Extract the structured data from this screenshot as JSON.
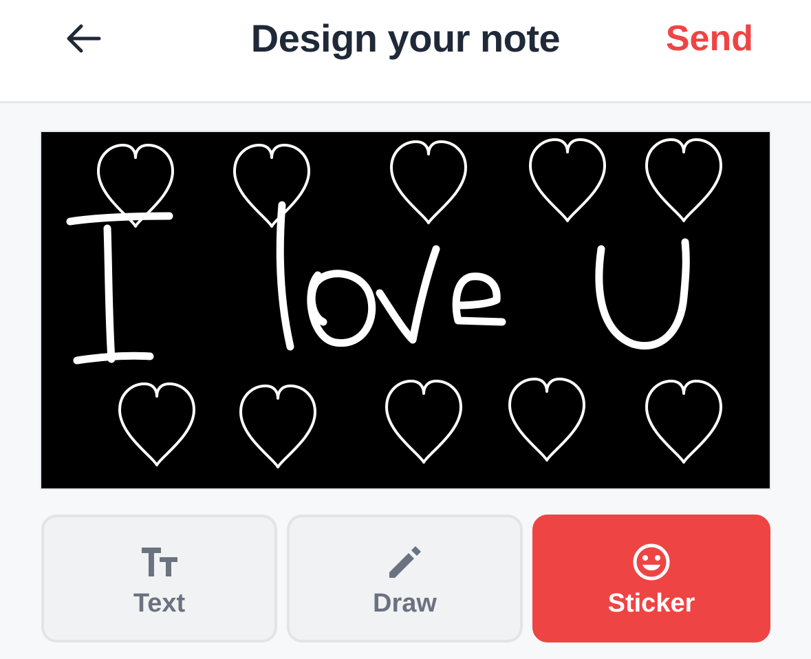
{
  "header": {
    "back_icon": "arrow-left-icon",
    "title": "Design your note",
    "send_label": "Send"
  },
  "canvas": {
    "background": "#000000",
    "ink_color": "#ffffff",
    "handwriting": "I love U",
    "sticker_icon": "heart-outline-icon",
    "sticker_count": 10
  },
  "tools": {
    "text": {
      "label": "Text",
      "icon": "text-size-icon"
    },
    "draw": {
      "label": "Draw",
      "icon": "pencil-icon"
    },
    "sticker": {
      "label": "Sticker",
      "icon": "smiley-face-icon",
      "selected": true
    }
  },
  "colors": {
    "accent": "#ef4444",
    "title": "#1f2937",
    "muted": "#6b7280"
  }
}
